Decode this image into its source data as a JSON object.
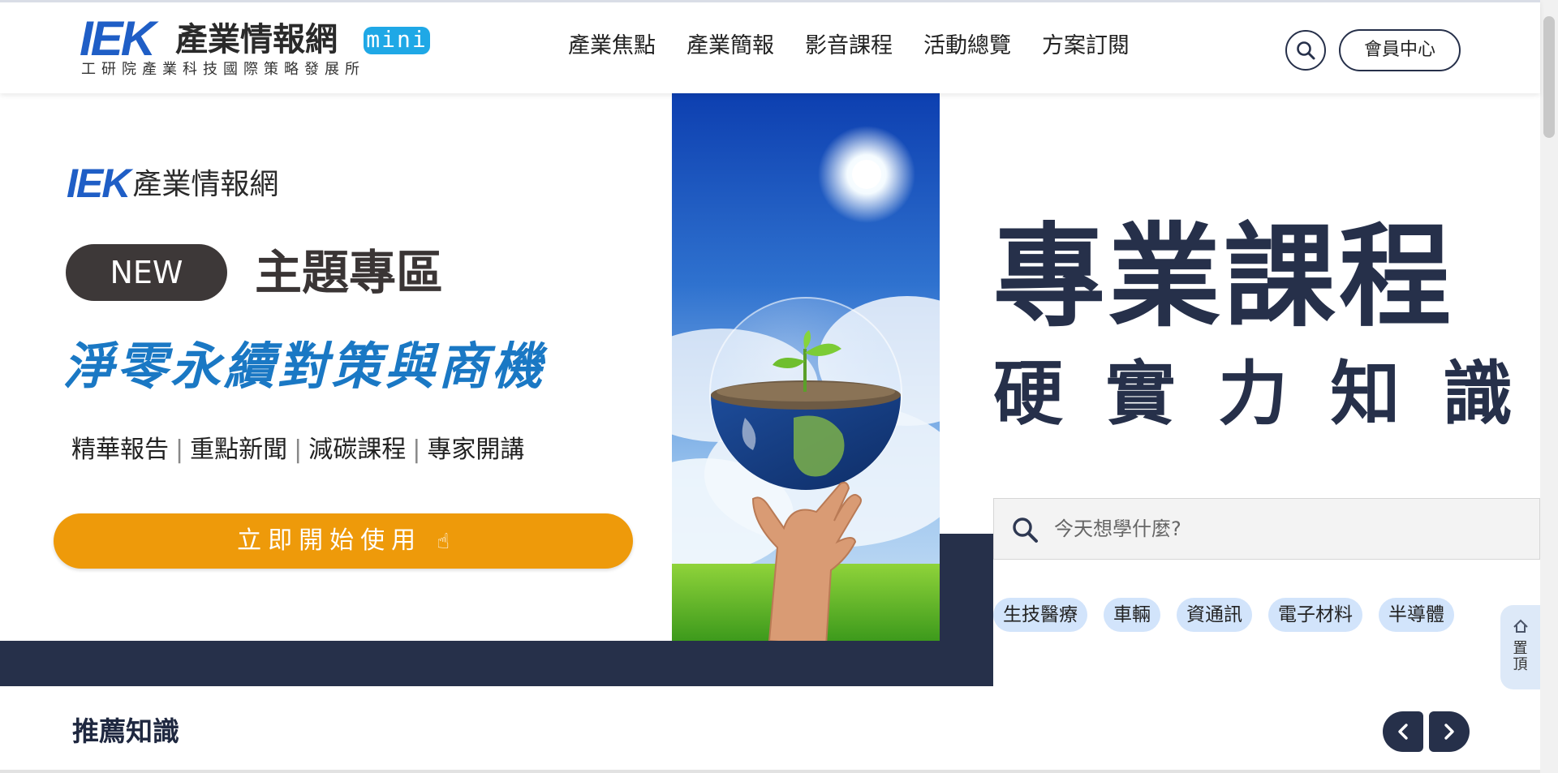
{
  "header": {
    "logo_iek": "IEK",
    "logo_cn": "產業情報網",
    "logo_mini": "mini",
    "logo_sub": "工研院產業科技國際策略發展所",
    "nav": [
      "產業焦點",
      "產業簡報",
      "影音課程",
      "活動總覽",
      "方案訂閱"
    ],
    "search_icon": "search-icon",
    "member_label": "會員中心"
  },
  "banner": {
    "logo_iek": "IEK",
    "logo_cn": "產業情報網",
    "new_label": "NEW",
    "topic_title": "主題專區",
    "blue_title": "淨零永續對策與商機",
    "tags": [
      "精華報告",
      "重點新聞",
      "減碳課程",
      "專家開講"
    ],
    "start_label": "立即開始使用",
    "start_icon": "pointing-hand-icon",
    "image": "globe-seedling-in-hand-image"
  },
  "promo": {
    "title": "專業課程",
    "subtitle": [
      "硬",
      "實",
      "力",
      "知",
      "識"
    ],
    "search_placeholder": "今天想學什麼?",
    "categories": [
      "生技醫療",
      "車輛",
      "資通訊",
      "電子材料",
      "半導體"
    ]
  },
  "to_top": {
    "label": "置頂",
    "icon": "house-up-icon"
  },
  "section": {
    "title": "推薦知識",
    "prev_icon": "chevron-left-icon",
    "next_icon": "chevron-right-icon"
  },
  "colors": {
    "brand_blue": "#1f5ec6",
    "navy": "#26304a",
    "orange": "#ee9a0a",
    "title_blue": "#1a78c4",
    "tag_bg": "#d2e4fb"
  }
}
